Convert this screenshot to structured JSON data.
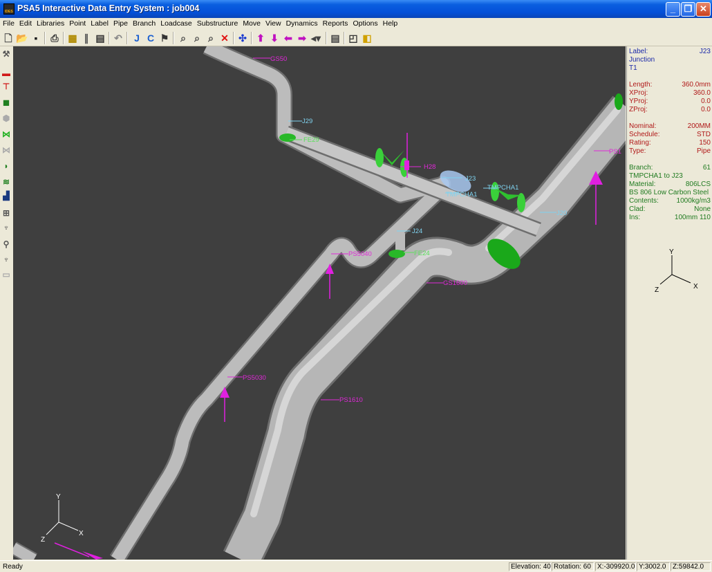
{
  "window": {
    "title": "PSA5 Interactive Data Entry System : job004"
  },
  "menu": [
    "File",
    "Edit",
    "Libraries",
    "Point",
    "Label",
    "Pipe",
    "Branch",
    "Loadcase",
    "Substructure",
    "Move",
    "View",
    "Dynamics",
    "Reports",
    "Options",
    "Help"
  ],
  "toolbar": {
    "icons": [
      "new-icon",
      "open-icon",
      "save-icon",
      "print-icon",
      "calculator-icon",
      "ruler-icon",
      "grid-icon",
      "undo-icon",
      "junction-j-icon",
      "connect-c-icon",
      "tee-icon",
      "zoom-window-icon",
      "zoom-in-icon",
      "zoom-out-icon",
      "delete-red-x-icon",
      "pan-icon",
      "arrow-up-icon",
      "arrow-down-icon",
      "arrow-left-icon",
      "arrow-right-icon",
      "view-dropdown-icon",
      "properties-icon",
      "wireframe-icon",
      "solid-icon"
    ]
  },
  "left_toolbar": {
    "icons": [
      "restraint-icon",
      "pipe-red-icon",
      "tee-red-icon",
      "flange-icon",
      "valve-grey-icon",
      "valve-green-icon",
      "valve-disabled-icon",
      "reducer-icon",
      "spring-icon",
      "support-icon",
      "hanger-icon",
      "snubber-icon",
      "anchor-icon",
      "guide-icon",
      "disabled-icon"
    ]
  },
  "viewport": {
    "labels": [
      {
        "text": "GS50",
        "color": "magenta"
      },
      {
        "text": "J29",
        "color": "cyan"
      },
      {
        "text": "FE29",
        "color": "green"
      },
      {
        "text": "H28",
        "color": "magenta"
      },
      {
        "text": "J23",
        "color": "cyan"
      },
      {
        "text": "TMPCHA1",
        "color": "cyan"
      },
      {
        "text": "TMPCHA1",
        "color": "cyan"
      },
      {
        "text": "J20",
        "color": "cyan"
      },
      {
        "text": "PS1",
        "color": "magenta"
      },
      {
        "text": "J24",
        "color": "cyan"
      },
      {
        "text": "FE24",
        "color": "green"
      },
      {
        "text": "PS5040",
        "color": "magenta"
      },
      {
        "text": "GS1600",
        "color": "magenta"
      },
      {
        "text": "PS5030",
        "color": "magenta"
      },
      {
        "text": "PS1610",
        "color": "magenta"
      }
    ],
    "axis_bottom": {
      "y": "Y",
      "x": "X",
      "z": "Z"
    }
  },
  "properties": {
    "label_key": "Label:",
    "label_val": "J23",
    "type_line": "Junction",
    "sub_line": "T1",
    "length_key": "Length:",
    "length_val": "360.0mm",
    "xproj_key": "XProj:",
    "xproj_val": "360.0",
    "yproj_key": "YProj:",
    "yproj_val": "0.0",
    "zproj_key": "ZProj:",
    "zproj_val": "0.0",
    "nominal_key": "Nominal:",
    "nominal_val": "200MM",
    "schedule_key": "Schedule:",
    "schedule_val": "STD",
    "rating_key": "Rating:",
    "rating_val": "150",
    "type_key": "Type:",
    "type_val": "Pipe",
    "branch_key": "Branch:",
    "branch_val": "61",
    "branch_line": "TMPCHA1 to J23",
    "material_key": "Material:",
    "material_val": "806LCS",
    "material_line": "BS 806 Low Carbon Steel",
    "contents_key": "Contents:",
    "contents_val": "1000kg/m3",
    "clad_key": "Clad:",
    "clad_val": "None",
    "ins_key": "Ins:",
    "ins_val": "100mm 110",
    "axis": {
      "y": "Y",
      "x": "X",
      "z": "Z"
    }
  },
  "status": {
    "ready": "Ready",
    "elevation": "Elevation: 40",
    "rotation": "Rotation: 60",
    "x": "X:-309920.0",
    "y": "Y:3002.0",
    "z": "Z:59842.0"
  },
  "colors": {
    "titlebar": "#0a5fe0",
    "viewport_bg": "#3f3f3f",
    "pipe": "#b8b8b8",
    "valve": "#2fbf2f",
    "support": "#e018e0",
    "node_label": "#7fd3f0"
  }
}
